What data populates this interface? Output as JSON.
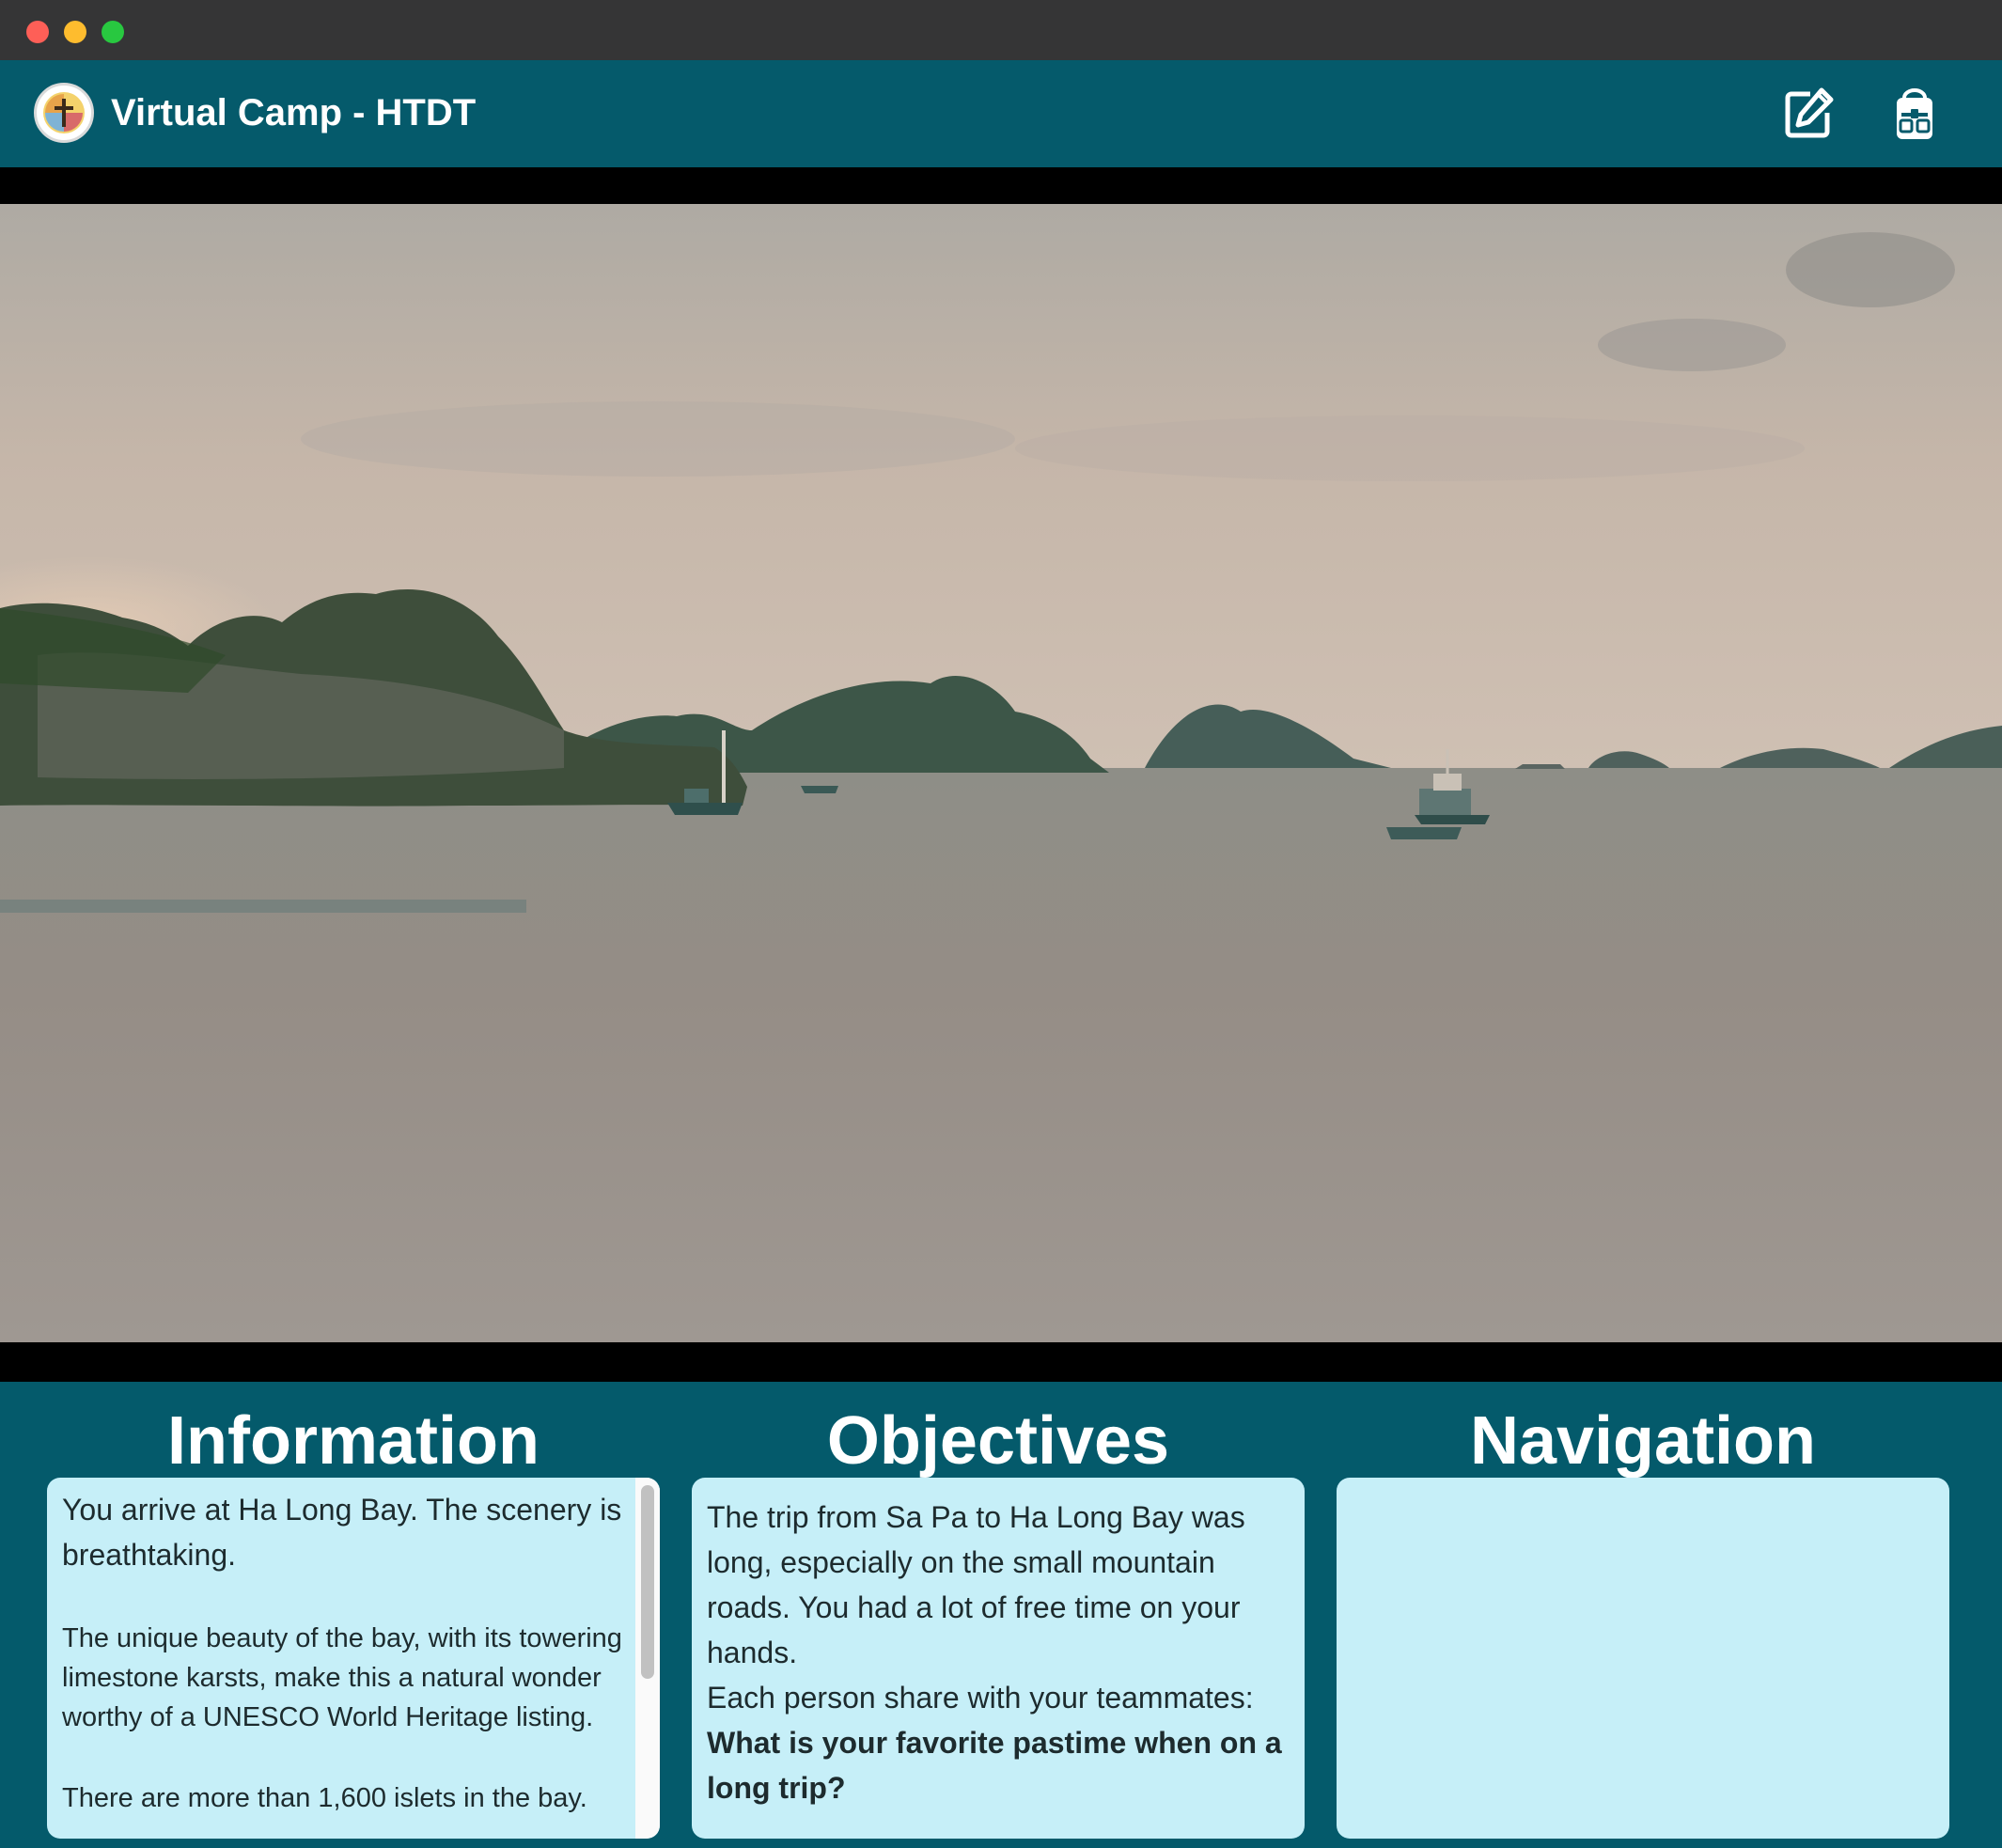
{
  "app": {
    "title": "Virtual Camp - HTDT"
  },
  "header": {
    "edit_icon": "edit-icon",
    "backpack_icon": "backpack-icon"
  },
  "scene": {
    "location": "Ha Long Bay"
  },
  "panels": {
    "information": {
      "heading": "Information",
      "paragraphs": [
        "You arrive at Ha Long Bay. The scenery is breathtaking.",
        "The unique beauty of the bay, with its towering limestone karsts, make this a natural wonder worthy of a UNESCO World Heritage listing.",
        "There are more than 1,600 islets in the bay."
      ]
    },
    "objectives": {
      "heading": "Objectives",
      "intro": "The trip from Sa Pa to Ha Long Bay was long, especially on the small mountain roads. You had a lot of free time on your hands.",
      "instruction": "Each person share with your teammates:",
      "question": "What is your favorite pastime when on a long trip?"
    },
    "navigation": {
      "heading": "Navigation"
    }
  },
  "colors": {
    "header_bg": "#055a6b",
    "panel_bg": "#c6eff8",
    "titlebar_bg": "#353536"
  }
}
